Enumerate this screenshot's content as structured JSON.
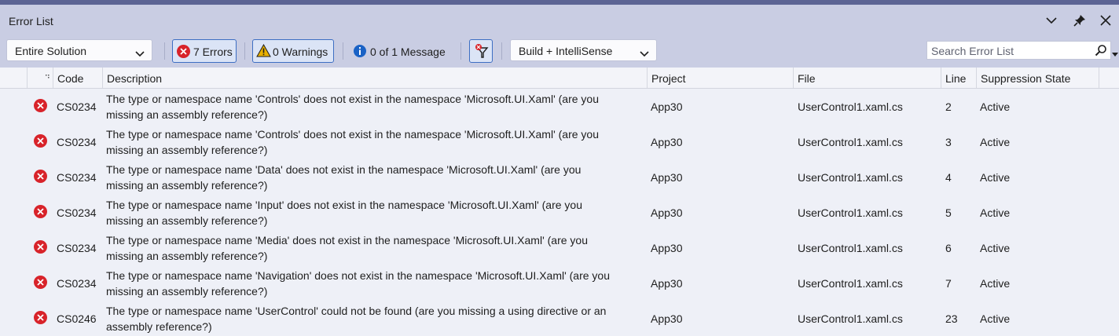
{
  "window": {
    "title": "Error List"
  },
  "toolbar": {
    "scope_label": "Entire Solution",
    "errors_label": "7 Errors",
    "warnings_label": "0 Warnings",
    "messages_label": "0 of 1 Message",
    "build_label": "Build + IntelliSense",
    "search_placeholder": "Search Error List"
  },
  "columns": {
    "code": "Code",
    "description": "Description",
    "project": "Project",
    "file": "File",
    "line": "Line",
    "suppression": "Suppression State"
  },
  "rows": [
    {
      "code": "CS0234",
      "desc1": "The type or namespace name 'Controls' does not exist in the namespace 'Microsoft.UI.Xaml' (are you",
      "desc2": "missing an assembly reference?)",
      "project": "App30",
      "file": "UserControl1.xaml.cs",
      "line": "2",
      "state": "Active"
    },
    {
      "code": "CS0234",
      "desc1": "The type or namespace name 'Controls' does not exist in the namespace 'Microsoft.UI.Xaml' (are you",
      "desc2": "missing an assembly reference?)",
      "project": "App30",
      "file": "UserControl1.xaml.cs",
      "line": "3",
      "state": "Active"
    },
    {
      "code": "CS0234",
      "desc1": "The type or namespace name 'Data' does not exist in the namespace 'Microsoft.UI.Xaml' (are you",
      "desc2": "missing an assembly reference?)",
      "project": "App30",
      "file": "UserControl1.xaml.cs",
      "line": "4",
      "state": "Active"
    },
    {
      "code": "CS0234",
      "desc1": "The type or namespace name 'Input' does not exist in the namespace 'Microsoft.UI.Xaml' (are you",
      "desc2": "missing an assembly reference?)",
      "project": "App30",
      "file": "UserControl1.xaml.cs",
      "line": "5",
      "state": "Active"
    },
    {
      "code": "CS0234",
      "desc1": "The type or namespace name 'Media' does not exist in the namespace 'Microsoft.UI.Xaml' (are you",
      "desc2": "missing an assembly reference?)",
      "project": "App30",
      "file": "UserControl1.xaml.cs",
      "line": "6",
      "state": "Active"
    },
    {
      "code": "CS0234",
      "desc1": "The type or namespace name 'Navigation' does not exist in the namespace 'Microsoft.UI.Xaml' (are you",
      "desc2": "missing an assembly reference?)",
      "project": "App30",
      "file": "UserControl1.xaml.cs",
      "line": "7",
      "state": "Active"
    },
    {
      "code": "CS0246",
      "desc1": "The type or namespace name 'UserControl' could not be found (are you missing a using directive or an",
      "desc2": "assembly reference?)",
      "project": "App30",
      "file": "UserControl1.xaml.cs",
      "line": "23",
      "state": "Active"
    }
  ],
  "colors": {
    "error": "#d8232a",
    "accent": "#3d6ec3",
    "warning": "#e8b000",
    "info": "#1a62c5"
  }
}
